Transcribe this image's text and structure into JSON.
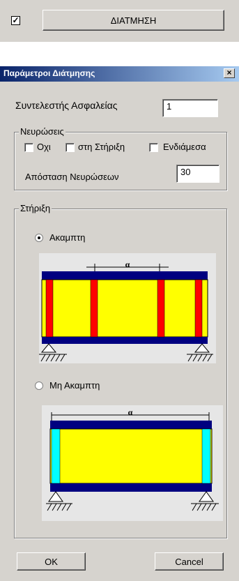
{
  "top": {
    "checkbox_mark": "✓",
    "button_label": "ΔΙΑΤΜΗΣΗ"
  },
  "dialog": {
    "title": "Παράμετροι Διάτμησης",
    "close_glyph": "×",
    "safety_factor_label": "Συντελεστής Ασφαλείας",
    "safety_factor_value": "1",
    "ribs": {
      "legend": "Νευρώσεις",
      "opt_none": "Οχι",
      "opt_support": "στη Στήριξη",
      "opt_middle": "Ενδιάμεσα",
      "spacing_label": "Απόσταση Νευρώσεων",
      "spacing_value": "30"
    },
    "support": {
      "legend": "Στήριξη",
      "rigid_label": "Ακαμπτη",
      "nonrigid_label": "Μη Ακαμπτη",
      "dim_label": "α"
    },
    "ok_label": "OK",
    "cancel_label": "Cancel"
  },
  "colors": {
    "web": "#ffff00",
    "flange": "#000080",
    "stiffener": "#ff0000",
    "end_plate": "#00ffff",
    "drawing_bg": "#e6e6e6"
  }
}
